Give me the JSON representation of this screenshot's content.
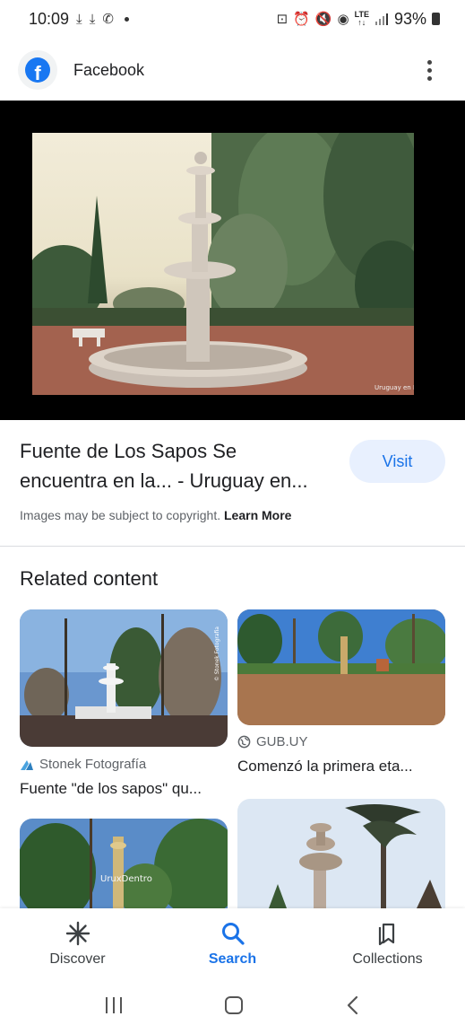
{
  "status_bar": {
    "time": "10:09",
    "battery": "93%",
    "network": "LTE"
  },
  "app_bar": {
    "title": "Facebook",
    "icon": "facebook-logo",
    "brand_color": "#1877f2"
  },
  "result": {
    "title_line1": "Fuente de Los Sapos Se",
    "title_line2": "encuentra en la... - Uruguay en...",
    "visit_label": "Visit",
    "copyright_text": "Images may be subject to copyright.",
    "learn_more": "Learn More",
    "watermark": "Uruguay en Fotos"
  },
  "related": {
    "heading": "Related content",
    "cards": [
      {
        "source": "Stonek Fotografía",
        "title": "Fuente \"de los sapos\" qu...",
        "source_icon": "stonek-logo",
        "watermark": "© Stonek Fotografia"
      },
      {
        "source": "GUB.UY",
        "title": "Comenzó la primera eta...",
        "source_icon": "globe-icon"
      },
      {
        "watermark": "UruxDentro"
      },
      {}
    ]
  },
  "bottom_nav": {
    "items": [
      {
        "label": "Discover",
        "icon": "asterisk-icon",
        "active": false
      },
      {
        "label": "Search",
        "icon": "search-icon",
        "active": true
      },
      {
        "label": "Collections",
        "icon": "collections-icon",
        "active": false
      }
    ]
  },
  "colors": {
    "accent": "#1a73e8",
    "visit_bg": "#e8f0fe"
  }
}
